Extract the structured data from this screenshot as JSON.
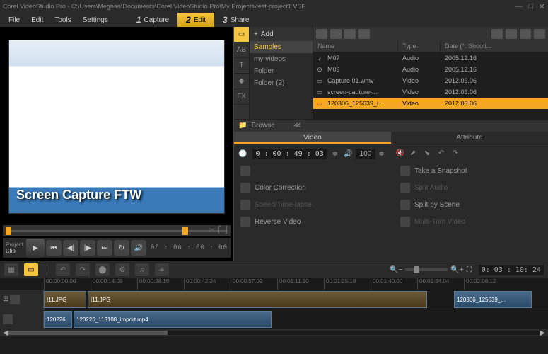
{
  "titlebar": {
    "title": "Corel VideoStudio Pro - C:\\Users\\Meghan\\Documents\\Corel VideoStudio Pro\\My Projects\\test-project1.VSP"
  },
  "menu": {
    "file": "File",
    "edit": "Edit",
    "tools": "Tools",
    "settings": "Settings"
  },
  "steps": {
    "s1_num": "1",
    "s1_label": "Capture",
    "s2_num": "2",
    "s2_label": "Edit",
    "s3_num": "3",
    "s3_label": "Share"
  },
  "preview": {
    "overlay_text": "Screen Capture FTW",
    "project_label": "Project",
    "clip_label": "Clip",
    "timecode": "00 : 00 : 00 : 00"
  },
  "library": {
    "add_label": "Add",
    "folders": {
      "samples": "Samples",
      "myvideos": "my videos",
      "folder": "Folder",
      "folder2": "Folder (2)"
    },
    "browse_label": "Browse",
    "headers": {
      "name": "Name",
      "type": "Type",
      "date": "Date (*: Shooti..."
    },
    "files": [
      {
        "name": "M07",
        "type": "Audio",
        "date": "2005.12.16"
      },
      {
        "name": "M09",
        "type": "Audio",
        "date": "2005.12.16"
      },
      {
        "name": "Capture 01.wmv",
        "type": "Video",
        "date": "2012.03.06"
      },
      {
        "name": "screen-capture-...",
        "type": "Video",
        "date": "2012.03.06"
      },
      {
        "name": "120306_125639_i...",
        "type": "Video",
        "date": "2012.03.06"
      }
    ]
  },
  "options": {
    "tab_video": "Video",
    "tab_attribute": "Attribute",
    "duration": "0 : 00 : 49 : 03",
    "volume": "100",
    "items": {
      "snapshot": "Take a Snapshot",
      "color": "Color Correction",
      "split_audio": "Split Audio",
      "speed": "Speed/Time-lapse",
      "split_scene": "Split by Scene",
      "reverse": "Reverse Video",
      "multitrim": "Multi-Trim Video"
    }
  },
  "timeline": {
    "duration": "0: 03 : 10: 24",
    "ruler": [
      "00:00:00.00",
      "00:00:14.08",
      "00:00:28.16",
      "00:00:42.24",
      "00:00:57.02",
      "00:01:11.10",
      "00:01:25.18",
      "00:01:40.00",
      "00:01:54.04",
      "00:02:08.12"
    ],
    "clips": {
      "c1": "I11.JPG",
      "c2": "I11.JPG",
      "c3": "120306_125639_...",
      "c4": "120226",
      "c5": "120226_113108_import.mp4"
    }
  }
}
